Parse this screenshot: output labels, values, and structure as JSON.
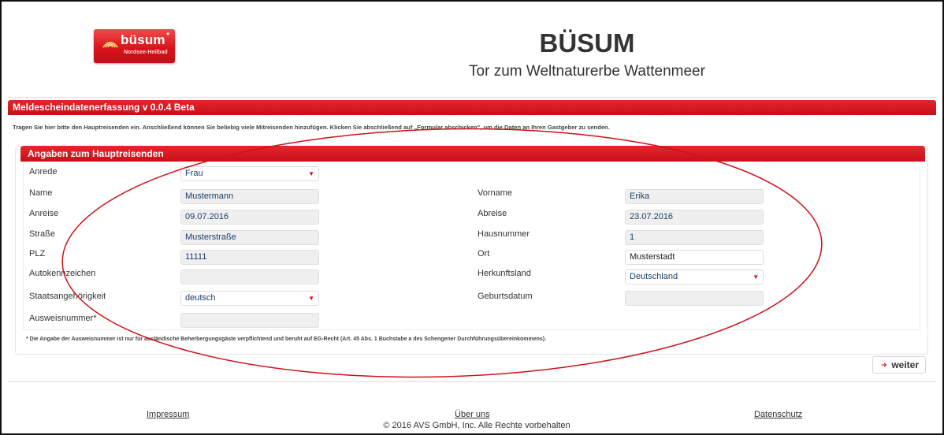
{
  "header": {
    "logo_word": "büsum",
    "logo_star": "*",
    "logo_sub": "Nordsee-Heilbad",
    "title": "BÜSUM",
    "subtitle": "Tor zum Weltnaturerbe Wattenmeer"
  },
  "app": {
    "title": "Meldescheindatenerfassung v 0.0.4 Beta",
    "intro": "Tragen Sie hier bitte den Hauptreisenden ein. Anschließend können Sie beliebig viele Mitreisenden hinzufügen. Klicken Sie abschließend auf „Formular abschicken\", um die Daten an Ihren Gastgeber zu senden."
  },
  "panel": {
    "title": "Angaben zum Hauptreisenden"
  },
  "form": {
    "anrede": {
      "label": "Anrede",
      "value": "Frau"
    },
    "name": {
      "label": "Name",
      "value": "Mustermann"
    },
    "vorname": {
      "label": "Vorname",
      "value": "Erika"
    },
    "anreise": {
      "label": "Anreise",
      "value": "09.07.2016"
    },
    "abreise": {
      "label": "Abreise",
      "value": "23.07.2016"
    },
    "strasse": {
      "label": "Straße",
      "value": "Musterstraße"
    },
    "hausnummer": {
      "label": "Hausnummer",
      "value": "1"
    },
    "plz": {
      "label": "PLZ",
      "value": "11111"
    },
    "ort": {
      "label": "Ort",
      "value": "Musterstadt"
    },
    "autokennzeichen": {
      "label": "Autokennzeichen",
      "value": ""
    },
    "herkunftsland": {
      "label": "Herkunftsland",
      "value": "Deutschland"
    },
    "staatsangehoerigkeit": {
      "label": "Staatsangehörigkeit",
      "value": "deutsch"
    },
    "geburtsdatum": {
      "label": "Geburtsdatum",
      "value": ""
    },
    "ausweisnummer": {
      "label": "Ausweisnummer*",
      "value": ""
    }
  },
  "footnote": "* Die Angabe der Ausweisnummer ist nur für ausländische Beherbergungsgäste verpflichtend und beruht auf EG-Recht (Art. 45 Abs. 1 Buchstabe a des Schengener Durchführungsübereinkommens).",
  "buttons": {
    "weiter": "weiter"
  },
  "footer": {
    "impressum": "Impressum",
    "ueber_uns": "Über uns",
    "datenschutz": "Datenschutz",
    "copyright": "© 2016 AVS GmbH, Inc. Alle Rechte vorbehalten"
  },
  "colors": {
    "accent": "#d0101a",
    "annotation": "#d0101a"
  }
}
